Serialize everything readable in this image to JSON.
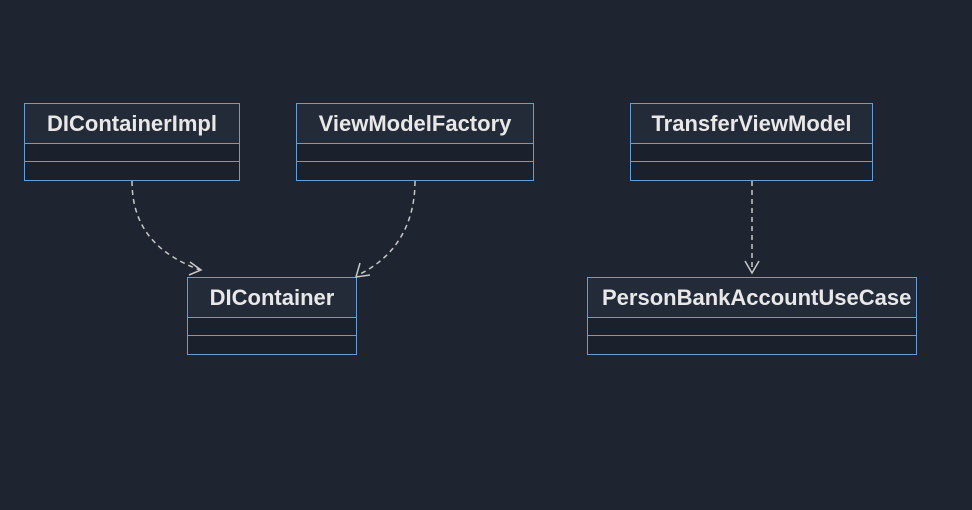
{
  "diagram": {
    "classes": {
      "dicontainerimpl": {
        "name": "DIContainerImpl"
      },
      "viewmodelfactory": {
        "name": "ViewModelFactory"
      },
      "transferviewmodel": {
        "name": "TransferViewModel"
      },
      "dicontainer": {
        "name": "DIContainer"
      },
      "personbankaccountusecase": {
        "name": "PersonBankAccountUseCase"
      }
    },
    "relationships": [
      {
        "from": "DIContainerImpl",
        "to": "DIContainer",
        "type": "dependency"
      },
      {
        "from": "ViewModelFactory",
        "to": "DIContainer",
        "type": "dependency"
      },
      {
        "from": "TransferViewModel",
        "to": "PersonBankAccountUseCase",
        "type": "dependency"
      }
    ]
  }
}
